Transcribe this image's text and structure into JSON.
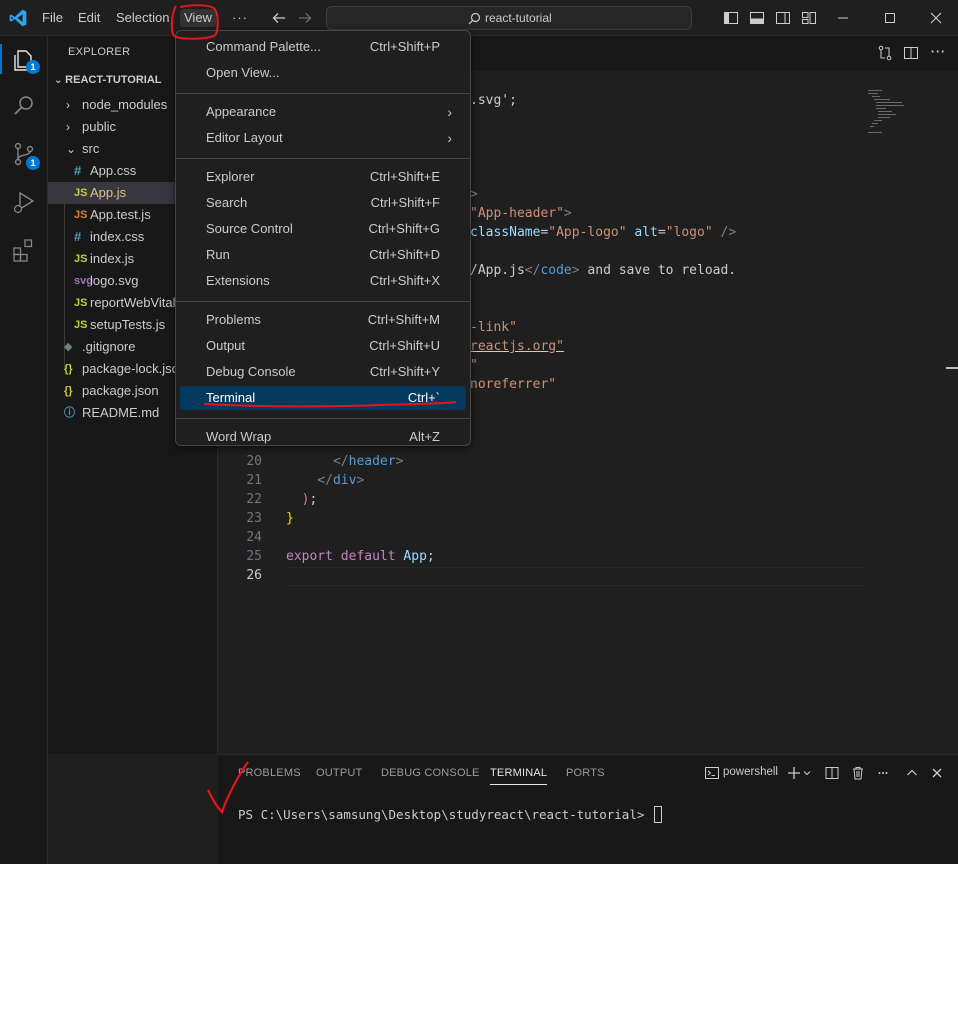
{
  "menubar": {
    "items": [
      "File",
      "Edit",
      "Selection",
      "View"
    ],
    "more": "···"
  },
  "search": {
    "text": "react-tutorial"
  },
  "activity": {
    "explorer_badge": "1",
    "scm_badge": "1"
  },
  "sidebar": {
    "title": "EXPLORER",
    "section": "REACT-TUTORIAL",
    "tree": [
      {
        "label": "node_modules",
        "kind": "folder",
        "state": "collapsed"
      },
      {
        "label": "public",
        "kind": "folder",
        "state": "collapsed"
      },
      {
        "label": "src",
        "kind": "folder",
        "state": "expanded"
      },
      {
        "label": "App.css",
        "kind": "css",
        "icon": "#"
      },
      {
        "label": "App.js",
        "kind": "js",
        "icon": "JS",
        "selected": true
      },
      {
        "label": "App.test.js",
        "kind": "jsr",
        "icon": "JS"
      },
      {
        "label": "index.css",
        "kind": "css",
        "icon": "#"
      },
      {
        "label": "index.js",
        "kind": "js",
        "icon": "JS"
      },
      {
        "label": "logo.svg",
        "kind": "svg",
        "icon": "svg"
      },
      {
        "label": "reportWebVitals.js",
        "kind": "js",
        "icon": "JS"
      },
      {
        "label": "setupTests.js",
        "kind": "js",
        "icon": "JS"
      },
      {
        "label": ".gitignore",
        "kind": "git",
        "icon": "◆"
      },
      {
        "label": "package-lock.json",
        "kind": "json",
        "icon": "{}"
      },
      {
        "label": "package.json",
        "kind": "json",
        "icon": "{}"
      },
      {
        "label": "README.md",
        "kind": "info",
        "icon": "ⓘ"
      }
    ]
  },
  "editor": {
    "visible_code": [
      {
        "ln": "",
        "parts": [
          [
            "plain",
            ".svg';"
          ]
        ]
      },
      {
        "ln": "",
        "parts": [
          [
            "ang",
            ">"
          ]
        ]
      },
      {
        "ln": "",
        "parts": [
          [
            "str",
            "\"App-header\""
          ],
          [
            "ang",
            ">"
          ]
        ]
      },
      {
        "ln": "",
        "parts": [
          [
            "attr",
            "className"
          ],
          [
            "plain",
            "="
          ],
          [
            "str",
            "\"App-logo\""
          ],
          [
            "plain",
            " "
          ],
          [
            "attr",
            "alt"
          ],
          [
            "plain",
            "="
          ],
          [
            "str",
            "\"logo\""
          ],
          [
            "plain",
            " "
          ],
          [
            "ang",
            "/>"
          ]
        ]
      },
      {
        "ln": "",
        "parts": [
          [
            "plain",
            "/App.js"
          ],
          [
            "ang",
            "</"
          ],
          [
            "tag",
            "code"
          ],
          [
            "ang",
            ">"
          ],
          [
            "plain",
            " and save to reload."
          ]
        ]
      },
      {
        "ln": "",
        "parts": [
          [
            "str",
            "-link\""
          ]
        ]
      },
      {
        "ln": "",
        "parts": [
          [
            "str",
            "reactjs.org\""
          ]
        ]
      },
      {
        "ln": "",
        "parts": [
          [
            "str",
            "\""
          ]
        ]
      },
      {
        "ln": "",
        "parts": [
          [
            "str",
            "noreferrer\""
          ]
        ]
      }
    ],
    "lines": [
      {
        "ln": "20",
        "indent": "      ",
        "parts": [
          [
            "ang",
            "</"
          ],
          [
            "tag",
            "header"
          ],
          [
            "ang",
            ">"
          ]
        ]
      },
      {
        "ln": "21",
        "indent": "    ",
        "parts": [
          [
            "ang",
            "</"
          ],
          [
            "tag",
            "div"
          ],
          [
            "ang",
            ">"
          ]
        ]
      },
      {
        "ln": "22",
        "indent": "  ",
        "parts": [
          [
            "paren",
            ")"
          ],
          [
            "plain",
            ";"
          ]
        ]
      },
      {
        "ln": "23",
        "indent": "",
        "parts": [
          [
            "brace2",
            "}"
          ]
        ]
      },
      {
        "ln": "24",
        "indent": "",
        "parts": []
      },
      {
        "ln": "25",
        "indent": "",
        "parts": [
          [
            "kw",
            "export"
          ],
          [
            "plain",
            " "
          ],
          [
            "kw",
            "default"
          ],
          [
            "plain",
            " "
          ],
          [
            "var",
            "App"
          ],
          [
            "plain",
            ";"
          ]
        ]
      },
      {
        "ln": "26",
        "indent": "",
        "parts": []
      }
    ]
  },
  "panel": {
    "tabs": [
      "PROBLEMS",
      "OUTPUT",
      "DEBUG CONSOLE",
      "TERMINAL",
      "PORTS"
    ],
    "active_tab": "TERMINAL",
    "shell": "powershell",
    "prompt": "PS C:\\Users\\samsung\\Desktop\\studyreact\\react-tutorial> "
  },
  "view_menu": {
    "groups": [
      [
        {
          "label": "Command Palette...",
          "shortcut": "Ctrl+Shift+P"
        },
        {
          "label": "Open View...",
          "shortcut": ""
        }
      ],
      [
        {
          "label": "Appearance",
          "shortcut": "",
          "submenu": true
        },
        {
          "label": "Editor Layout",
          "shortcut": "",
          "submenu": true
        }
      ],
      [
        {
          "label": "Explorer",
          "shortcut": "Ctrl+Shift+E"
        },
        {
          "label": "Search",
          "shortcut": "Ctrl+Shift+F"
        },
        {
          "label": "Source Control",
          "shortcut": "Ctrl+Shift+G"
        },
        {
          "label": "Run",
          "shortcut": "Ctrl+Shift+D"
        },
        {
          "label": "Extensions",
          "shortcut": "Ctrl+Shift+X"
        }
      ],
      [
        {
          "label": "Problems",
          "shortcut": "Ctrl+Shift+M"
        },
        {
          "label": "Output",
          "shortcut": "Ctrl+Shift+U"
        },
        {
          "label": "Debug Console",
          "shortcut": "Ctrl+Shift+Y"
        },
        {
          "label": "Terminal",
          "shortcut": "Ctrl+`",
          "highlighted": true
        }
      ],
      [
        {
          "label": "Word Wrap",
          "shortcut": "Alt+Z"
        }
      ]
    ]
  },
  "colors": {
    "accent": "#0078d4",
    "menu_highlight": "#04395e",
    "annotation_red": "#e8131c"
  }
}
